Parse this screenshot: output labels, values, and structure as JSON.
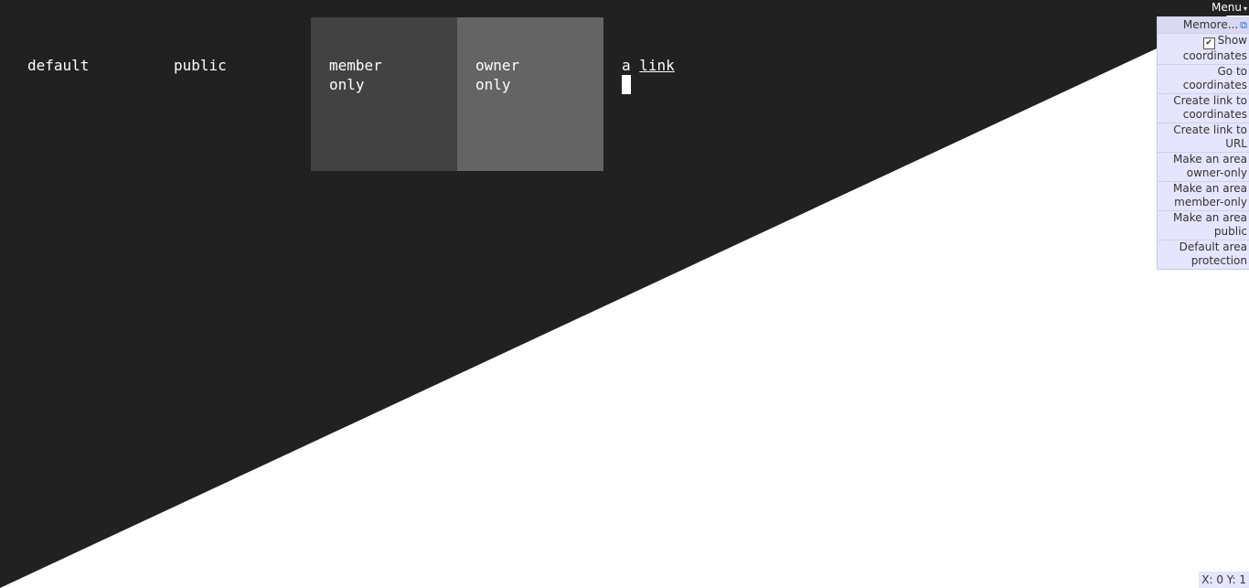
{
  "cells": {
    "default": "default",
    "public": "public",
    "member": "member\nonly",
    "owner": "owner\nonly",
    "link_prefix": "a ",
    "link_text": "link"
  },
  "menu": {
    "button_label": "Menu",
    "arrow": "▾",
    "items": [
      {
        "label": "Mem​ore...",
        "icon": "external-link-icon"
      },
      {
        "label": "Show coordinates",
        "checked": true
      },
      {
        "label": "Go to coordinates"
      },
      {
        "label": "Create link to coordinates"
      },
      {
        "label": "Create link to URL"
      },
      {
        "label": "Make an area owner-only"
      },
      {
        "label": "Make an area member-only"
      },
      {
        "label": "Make an area public"
      },
      {
        "label": "Default area protection"
      }
    ]
  },
  "coordinates": "X: 0 Y: 1",
  "colors": {
    "background_dark": "#212121",
    "member_cell": "#424242",
    "owner_cell": "#646464",
    "menu_bg": "#e5e5ff"
  }
}
